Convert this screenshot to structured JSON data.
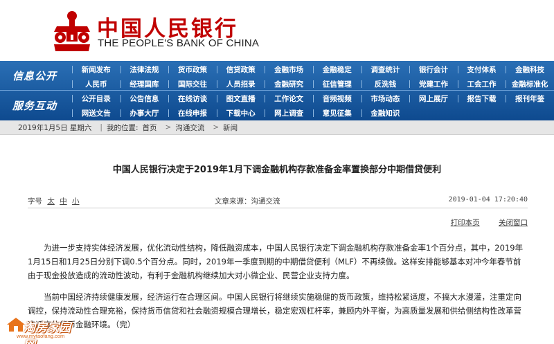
{
  "header": {
    "title_cn": "中国人民银行",
    "title_en": "THE PEOPLE'S BANK OF CHINA",
    "brand_color": "#c00000"
  },
  "nav": {
    "section1_label": "信息公开",
    "section2_label": "服务互动",
    "row1": [
      "新闻发布",
      "法律法规",
      "货币政策",
      "信贷政策",
      "金融市场",
      "金融稳定",
      "调查统计",
      "银行会计",
      "支付体系",
      "金融科技"
    ],
    "row2": [
      "人民币",
      "经理国库",
      "国际交往",
      "人员招录",
      "金融研究",
      "征信管理",
      "反洗钱",
      "党建工作",
      "工会工作",
      "金融标准化"
    ],
    "row3": [
      "公开目录",
      "公告信息",
      "在线访谈",
      "图文直播",
      "工作论文",
      "音频视频",
      "市场动态",
      "网上展厅",
      "报告下载",
      "报刊年鉴"
    ],
    "row4": [
      "网送文告",
      "办事大厅",
      "在线申报",
      "下载中心",
      "网上调查",
      "意见征集",
      "金融知识"
    ]
  },
  "breadcrumb": {
    "date": "2019年1月5日 星期六",
    "location_label": "我的位置:",
    "home": "首页",
    "section": "沟通交流",
    "page": "新闻"
  },
  "article": {
    "title": "中国人民银行决定于2019年1月下调金融机构存款准备金率置换部分中期借贷便利",
    "font_size_label": "字号",
    "font_size_options": [
      "太",
      "中",
      "小"
    ],
    "source": "文章来源：沟通交流",
    "datetime": "2019-01-04 17:20:40",
    "print_label": "打印本页",
    "close_label": "关闭窗口",
    "paragraphs": [
      "为进一步支持实体经济发展，优化流动性结构，降低融资成本，中国人民银行决定下调金融机构存款准备金率1个百分点，其中，2019年1月15日和1月25日分别下调0.5个百分点。同时，2019年一季度到期的中期借贷便利（MLF）不再续做。这样安排能够基本对冲今年春节前由于现金投放造成的流动性波动，有利于金融机构继续加大对小微企业、民营企业支持力度。",
      "当前中国经济持续健康发展，经济运行在合理区间。中国人民银行将继续实施稳健的货币政策，维持松紧适度，不搞大水漫灌，注重定向调控，保持流动性合理充裕，保持货币信贷和社会融资规模合理增长，稳定宏观杠杆率，兼顾内外平衡，为高质量发展和供给侧结构性改革营造适宜的货币金融环境。（完）"
    ]
  },
  "watermark": {
    "text": "淘房家园网",
    "url": "www.mytaofang.com"
  }
}
